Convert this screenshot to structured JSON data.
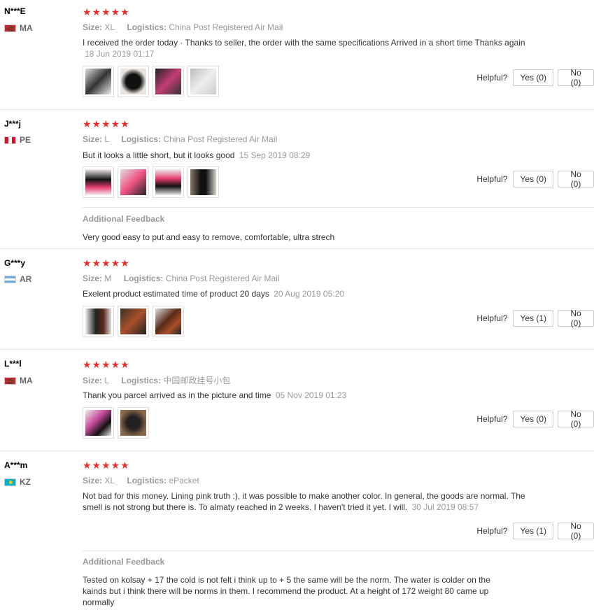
{
  "labels": {
    "size": "Size:",
    "logistics": "Logistics:",
    "helpful": "Helpful?",
    "additional": "Additional Feedback"
  },
  "colors": {
    "star": "#e62e2e",
    "muted": "#999999",
    "divider": "#e8e8e8"
  },
  "reviews": [
    {
      "user": "N***E",
      "country": "MA",
      "flag_icon": "flag-morocco-icon",
      "stars": "★★★★★",
      "size": "XL",
      "logistics": "China Post Registered Air Mail",
      "text": "I received the order today · Thanks to seller, the order with the same specifications Arrived in a short time Thanks again",
      "date": "18 Jun 2019 01:17",
      "photos": [
        "photo-1",
        "photo-2",
        "photo-3",
        "photo-4"
      ],
      "yes": "Yes (0)",
      "no": "No (0)"
    },
    {
      "user": "J***j",
      "country": "PE",
      "flag_icon": "flag-peru-icon",
      "stars": "★★★★★",
      "size": "L",
      "logistics": "China Post Registered Air Mail",
      "text": "But it looks a little short, but it looks good",
      "date": "15 Sep 2019 08:29",
      "photos": [
        "photo-1",
        "photo-2",
        "photo-3",
        "photo-4"
      ],
      "yes": "Yes (0)",
      "no": "No (0)",
      "additional": "Very good easy to put and easy to remove, comfortable, ultra strech"
    },
    {
      "user": "G***y",
      "country": "AR",
      "flag_icon": "flag-argentina-icon",
      "stars": "★★★★★",
      "size": "M",
      "logistics": "China Post Registered Air Mail",
      "text": "Exelent product estimated time of product 20 days",
      "date": "20 Aug 2019 05:20",
      "photos": [
        "photo-1",
        "photo-2",
        "photo-3"
      ],
      "yes": "Yes (1)",
      "no": "No (0)"
    },
    {
      "user": "L***l",
      "country": "MA",
      "flag_icon": "flag-morocco-icon",
      "stars": "★★★★★",
      "size": "L",
      "logistics": "中国邮政挂号小包",
      "text": "Thank you parcel arrived as in the picture and time",
      "date": "05 Nov 2019 01:23",
      "photos": [
        "photo-1",
        "photo-2"
      ],
      "yes": "Yes (0)",
      "no": "No (0)"
    },
    {
      "user": "A***m",
      "country": "KZ",
      "flag_icon": "flag-kazakhstan-icon",
      "stars": "★★★★★",
      "size": "XL",
      "logistics": "ePacket",
      "text": "Not bad for this money. Lining pink truth :), it was possible to make another color. In general, the goods are normal. The smell is not strong but there is. To almaty reached in 2 weeks. I haven't tried it yet. I will.",
      "date": "30 Jul 2019 08:57",
      "photos": [],
      "yes": "Yes (1)",
      "no": "No (0)",
      "additional": "Tested on kolsay + 17 the cold is not felt i think up to + 5 the same will be the norm. The water is colder on the kainds but i think there will be norms in them. I recommend the product. At a height of 172 weight 80 came up normally"
    }
  ]
}
